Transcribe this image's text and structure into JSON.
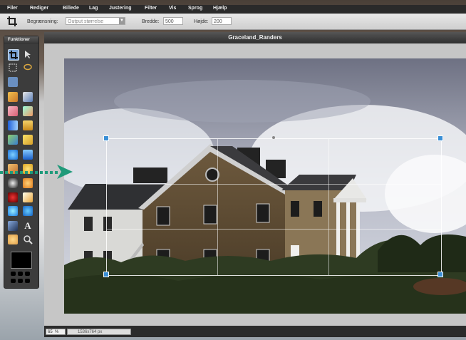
{
  "menu": [
    "Filer",
    "Rediger",
    "Billede",
    "Lag",
    "Justering",
    "Filter",
    "Vis",
    "Sprog",
    "Hjælp"
  ],
  "options": {
    "constraint_label": "Begrænsning:",
    "constraint_value": "Output størrelse",
    "width_label": "Bredde:",
    "width_value": "500",
    "height_label": "Højde:",
    "height_value": "200"
  },
  "toolbox": {
    "title": "Funktioner"
  },
  "document": {
    "title": "Graceland_Randers"
  },
  "status": {
    "zoom": "65",
    "zoom_unit": "%",
    "image_size": "1536x764 px"
  },
  "colors": {
    "selection_handle": "#3a8fd6",
    "annotation_arrow": "#1f9a7a",
    "menu_bg": "#2a2a2a",
    "canvas_bg": "#c6c6c6"
  },
  "icons": [
    "crop-icon",
    "move-icon",
    "marquee-icon",
    "lasso-icon",
    "wand-icon",
    "pencil-icon",
    "brush-icon",
    "eraser-icon",
    "replace-color-icon",
    "gradient-icon",
    "bucket-icon",
    "clone-icon",
    "heal-icon",
    "blur-icon",
    "sharpen-icon",
    "smudge-icon",
    "sponge-icon",
    "dodge-icon",
    "burn-icon",
    "redeye-icon",
    "spot-heal-icon",
    "bloat-icon",
    "pinch-icon",
    "picker-icon",
    "text-icon",
    "hand-icon",
    "zoom-icon"
  ]
}
